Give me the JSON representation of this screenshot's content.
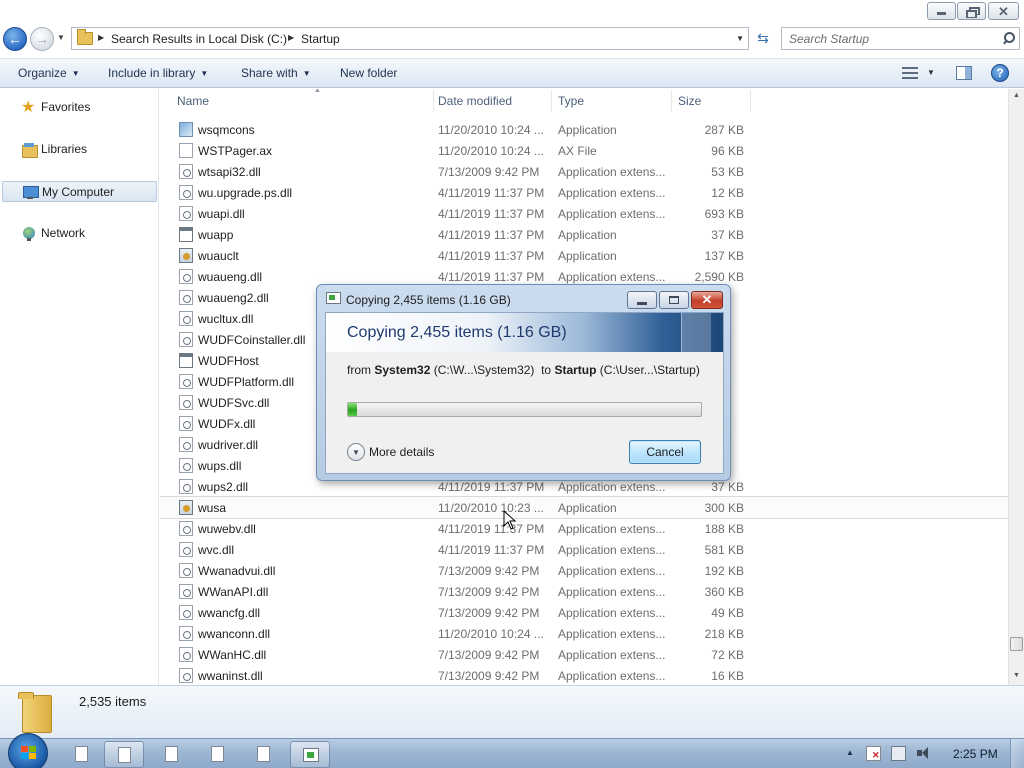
{
  "window": {
    "address": {
      "crumbs": [
        "Search Results in Local Disk (C:)",
        "Startup"
      ]
    },
    "search": {
      "placeholder": "Search Startup"
    }
  },
  "toolbar": {
    "organize": "Organize",
    "include": "Include in library",
    "share": "Share with",
    "new_folder": "New folder"
  },
  "sidebar": {
    "items": [
      {
        "label": "Favorites"
      },
      {
        "label": "Libraries"
      },
      {
        "label": "My Computer"
      },
      {
        "label": "Network"
      }
    ]
  },
  "columns": {
    "name": "Name",
    "date": "Date modified",
    "type": "Type",
    "size": "Size"
  },
  "files": [
    {
      "name": "wsqmcons",
      "date": "11/20/2010 10:24 ...",
      "type": "Application",
      "size": "287 KB",
      "icon": "application-icon"
    },
    {
      "name": "WSTPager.ax",
      "date": "11/20/2010 10:24 ...",
      "type": "AX File",
      "size": "96 KB",
      "icon": "ax-file-icon"
    },
    {
      "name": "wtsapi32.dll",
      "date": "7/13/2009 9:42 PM",
      "type": "Application extens...",
      "size": "53 KB",
      "icon": "dll-icon"
    },
    {
      "name": "wu.upgrade.ps.dll",
      "date": "4/11/2019 11:37 PM",
      "type": "Application extens...",
      "size": "12 KB",
      "icon": "dll-icon"
    },
    {
      "name": "wuapi.dll",
      "date": "4/11/2019 11:37 PM",
      "type": "Application extens...",
      "size": "693 KB",
      "icon": "dll-icon"
    },
    {
      "name": "wuapp",
      "date": "4/11/2019 11:37 PM",
      "type": "Application",
      "size": "37 KB",
      "icon": "application-icon"
    },
    {
      "name": "wuauclt",
      "date": "4/11/2019 11:37 PM",
      "type": "Application",
      "size": "137 KB",
      "icon": "application-icon"
    },
    {
      "name": "wuaueng.dll",
      "date": "4/11/2019 11:37 PM",
      "type": "Application extens...",
      "size": "2,590 KB",
      "icon": "dll-icon"
    },
    {
      "name": "wuaueng2.dll",
      "date": "",
      "type": "",
      "size": "",
      "icon": "dll-icon"
    },
    {
      "name": "wucltux.dll",
      "date": "",
      "type": "",
      "size": "",
      "icon": "dll-icon"
    },
    {
      "name": "WUDFCoinstaller.dll",
      "date": "",
      "type": "",
      "size": "",
      "icon": "dll-icon"
    },
    {
      "name": "WUDFHost",
      "date": "",
      "type": "",
      "size": "",
      "icon": "application-icon"
    },
    {
      "name": "WUDFPlatform.dll",
      "date": "",
      "type": "",
      "size": "",
      "icon": "dll-icon"
    },
    {
      "name": "WUDFSvc.dll",
      "date": "",
      "type": "",
      "size": "",
      "icon": "dll-icon"
    },
    {
      "name": "WUDFx.dll",
      "date": "",
      "type": "",
      "size": "",
      "icon": "dll-icon"
    },
    {
      "name": "wudriver.dll",
      "date": "",
      "type": "",
      "size": "",
      "icon": "dll-icon"
    },
    {
      "name": "wups.dll",
      "date": "",
      "type": "",
      "size": "",
      "icon": "dll-icon"
    },
    {
      "name": "wups2.dll",
      "date": "4/11/2019 11:37 PM",
      "type": "Application extens...",
      "size": "37 KB",
      "icon": "dll-icon"
    },
    {
      "name": "wusa",
      "date": "11/20/2010 10:23 ...",
      "type": "Application",
      "size": "300 KB",
      "icon": "application-icon"
    },
    {
      "name": "wuwebv.dll",
      "date": "4/11/2019 11:37 PM",
      "type": "Application extens...",
      "size": "188 KB",
      "icon": "dll-icon"
    },
    {
      "name": "wvc.dll",
      "date": "4/11/2019 11:37 PM",
      "type": "Application extens...",
      "size": "581 KB",
      "icon": "dll-icon"
    },
    {
      "name": "Wwanadvui.dll",
      "date": "7/13/2009 9:42 PM",
      "type": "Application extens...",
      "size": "192 KB",
      "icon": "dll-icon"
    },
    {
      "name": "WWanAPI.dll",
      "date": "7/13/2009 9:42 PM",
      "type": "Application extens...",
      "size": "360 KB",
      "icon": "dll-icon"
    },
    {
      "name": "wwancfg.dll",
      "date": "7/13/2009 9:42 PM",
      "type": "Application extens...",
      "size": "49 KB",
      "icon": "dll-icon"
    },
    {
      "name": "wwanconn.dll",
      "date": "11/20/2010 10:24 ...",
      "type": "Application extens...",
      "size": "218 KB",
      "icon": "dll-icon"
    },
    {
      "name": "WWanHC.dll",
      "date": "7/13/2009 9:42 PM",
      "type": "Application extens...",
      "size": "72 KB",
      "icon": "dll-icon"
    },
    {
      "name": "wwaninst.dll",
      "date": "7/13/2009 9:42 PM",
      "type": "Application extens...",
      "size": "16 KB",
      "icon": "dll-icon"
    }
  ],
  "status": {
    "items_count": "2,535 items"
  },
  "dialog": {
    "title": "Copying 2,455 items (1.16 GB)",
    "heading": "Copying 2,455 items (1.16 GB)",
    "from_word": "from",
    "source_name": "System32",
    "source_path": "(C:\\W...\\System32)",
    "to_word": "to",
    "dest_name": "Startup",
    "dest_path": "(C:\\User...\\Startup)",
    "progress_fraction": 0.025,
    "progress_color": "#24a51b",
    "more_details": "More details",
    "cancel": "Cancel"
  },
  "taskbar": {
    "clock": "2:25 PM"
  }
}
